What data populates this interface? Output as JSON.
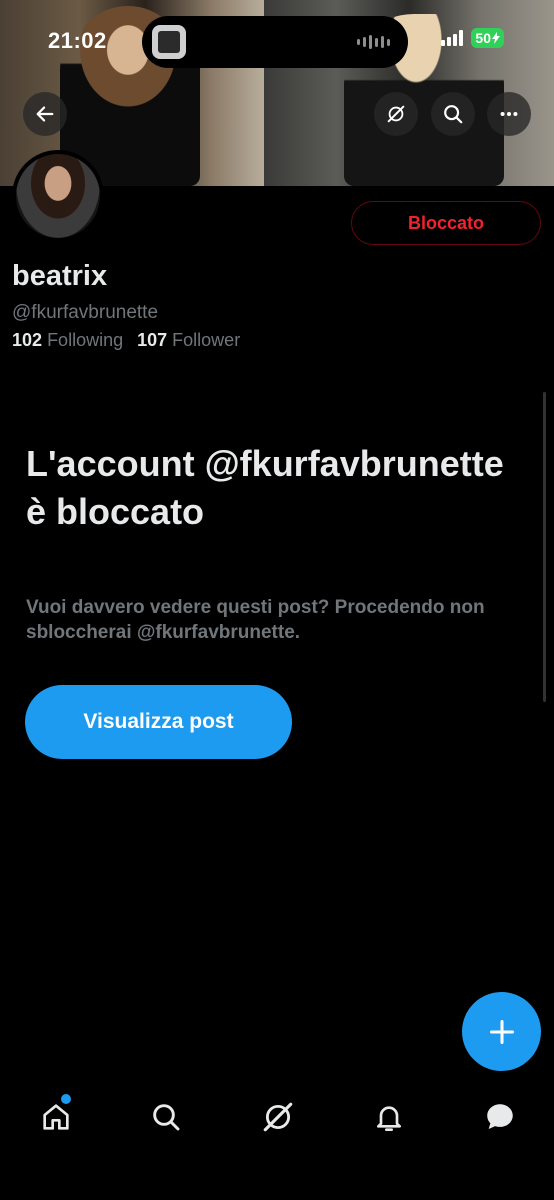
{
  "status_bar": {
    "time": "21:02",
    "battery": "50"
  },
  "header": {
    "back_icon": "arrow-left-icon",
    "grok_icon": "grok-icon",
    "search_icon": "search-icon",
    "more_icon": "more-horizontal-icon"
  },
  "profile": {
    "blocked_label": "Bloccato",
    "display_name": "beatrix",
    "handle": "@fkurfavbrunette",
    "following_count": "102",
    "following_label": "Following",
    "follower_count": "107",
    "follower_label": "Follower"
  },
  "blocked_notice": {
    "title": "L'account @fkurfavbrunette è bloccato",
    "description": "Vuoi davvero vedere questi post? Procedendo non sbloccherai @fkurfavbrunette.",
    "view_posts_label": "Visualizza post"
  },
  "fab": {
    "icon": "plus-icon"
  },
  "tabbar": {
    "items": [
      "home-icon",
      "search-icon",
      "grok-icon",
      "bell-icon",
      "messages-icon"
    ]
  },
  "colors": {
    "accent": "#1d9bf0",
    "blocked_red": "#f4212e",
    "secondary_text": "#71767b",
    "battery_green": "#30d158"
  }
}
